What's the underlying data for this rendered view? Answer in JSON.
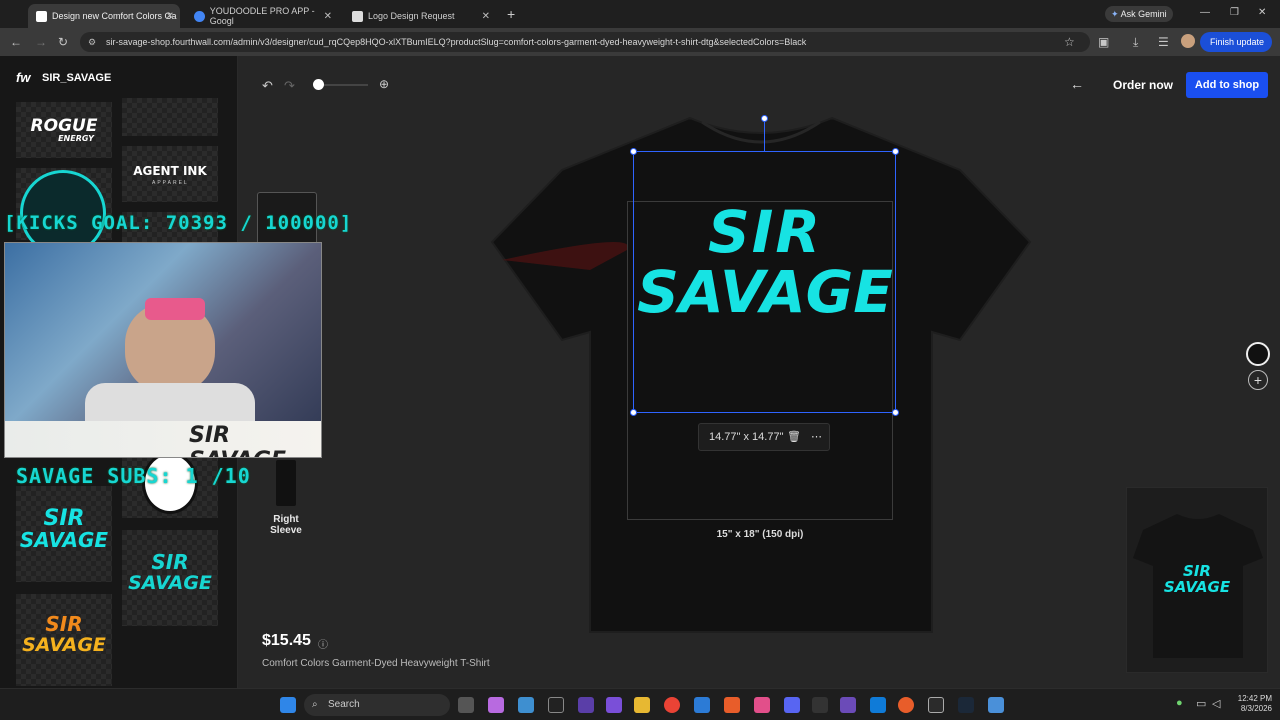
{
  "browser": {
    "tabs": [
      {
        "title": "Design new Comfort Colors Ga",
        "active": true
      },
      {
        "title": "YOUDOODLE PRO APP - Googl",
        "active": false
      },
      {
        "title": "Logo Design Request",
        "active": false
      }
    ],
    "new_tab": "+",
    "ask_gemini": "Ask Gemini",
    "url": "sir-savage-shop.fourthwall.com/admin/v3/designer/cud_rqCQep8HQO-xlXTBumIELQ?productSlug=comfort-colors-garment-dyed-heavyweight-t-shirt-dtg&selectedColors=Black",
    "finish_update": "Finish update"
  },
  "sidebar": {
    "brand_mark": "fw",
    "shop_name": "SIR_SAVAGE",
    "thumbs": {
      "rogue_title": "ROGUE",
      "rogue_sub": "ENERGY",
      "agent_ink": "AGENT INK",
      "agent_ink_sub": "APPAREL",
      "sir_1": "SIR",
      "savage_1": "SAVAGE",
      "sir_2": "SIR",
      "savage_2": "SAVAGE",
      "sir_3": "SIR",
      "savage_3": "SAVAGE"
    },
    "right_sleeve": "Right\nSleeve"
  },
  "stream_overlay": {
    "kicks_goal": "[KICKS GOAL: 70393 / 100000]",
    "savage_subs": "SAVAGE SUBS: 1 /10",
    "banner": "SIR SAVAGE"
  },
  "toolbar": {
    "order_now": "Order now",
    "add_to_shop": "Add to shop"
  },
  "design": {
    "logo_line1": "SIR",
    "logo_line2": "SAVAGE",
    "size_readout": "14.77\" x 14.77\"",
    "print_area": "15\" x 18\" (150 dpi)"
  },
  "product": {
    "price": "$15.45",
    "name": "Comfort Colors Garment-Dyed Heavyweight T-Shirt",
    "preview_sir": "SIR",
    "preview_savage": "SAVAGE"
  },
  "taskbar": {
    "search": "Search",
    "time": "12:42 PM",
    "date": "8/3/2026"
  },
  "colors": {
    "accent": "#1a4ff0",
    "logo_cyan": "#17e3e3",
    "shirt": "#111111"
  }
}
